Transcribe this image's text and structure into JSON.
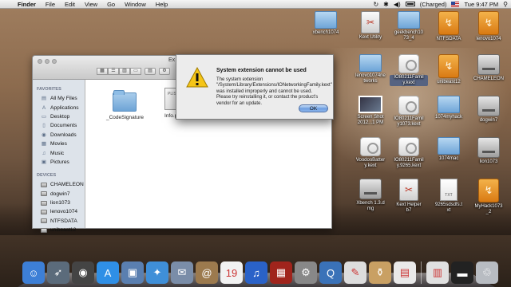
{
  "menubar": {
    "apple_glyph": "",
    "items": [
      "Finder",
      "File",
      "Edit",
      "View",
      "Go",
      "Window",
      "Help"
    ],
    "battery_text": "(Charged)",
    "clock": "Tue 9:47 PM"
  },
  "finder": {
    "title_fragment": "Ex",
    "sidebar": {
      "favorites_header": "FAVORITES",
      "favorites": [
        {
          "label": "All My Files",
          "icon": "all-files-icon"
        },
        {
          "label": "Applications",
          "icon": "applications-icon"
        },
        {
          "label": "Desktop",
          "icon": "desktop-icon"
        },
        {
          "label": "Documents",
          "icon": "documents-icon"
        },
        {
          "label": "Downloads",
          "icon": "downloads-icon"
        },
        {
          "label": "Movies",
          "icon": "movies-icon"
        },
        {
          "label": "Music",
          "icon": "music-icon"
        },
        {
          "label": "Pictures",
          "icon": "pictures-icon"
        }
      ],
      "devices_header": "DEVICES",
      "devices": [
        "CHAMELEON",
        "dogwin7",
        "lion1073",
        "lenovo1074",
        "NTFSDATA",
        "unibeast12"
      ]
    },
    "files": [
      {
        "name": "_CodeSignature",
        "kind": "folder"
      },
      {
        "name": "Info.p",
        "kind": "plist",
        "tag": "PLIST"
      }
    ]
  },
  "alert": {
    "title": "System extension cannot be used",
    "message": "The system extension \"/System/Library/Extensions/IONetworkingFamily.kext\" was installed improperly and cannot be used. Please try reinstalling it, or contact the product's vendor for an update.",
    "ok_label": "OK"
  },
  "desktop_icons": [
    {
      "label": "xbench1074",
      "icon": "folder-icon"
    },
    {
      "label": "Kext Utility",
      "icon": "kext-utility-icon"
    },
    {
      "label": "geekbench10\n73_4",
      "icon": "folder-icon"
    },
    {
      "label": "NTFSDATA",
      "icon": "usb-drive-icon"
    },
    {
      "label": "lenovo1074",
      "icon": "usb-drive-icon"
    },
    {
      "label": "lenovo1074ne\ntworks",
      "icon": "folder-icon"
    },
    {
      "label": "IO80211Famil\ny.kext",
      "icon": "kext-icon"
    },
    {
      "label": "unibeast12",
      "icon": "usb-drive-icon"
    },
    {
      "label": "CHAMELEON",
      "icon": "disk-icon"
    },
    {
      "label": "Screen Shot\n2012...1 PM",
      "icon": "screenshot-icon"
    },
    {
      "label": "IO80211Famil\ny1073.kext",
      "icon": "kext-icon"
    },
    {
      "label": "1074myhack",
      "icon": "folder-icon"
    },
    {
      "label": "dogwin7",
      "icon": "disk-icon"
    },
    {
      "label": "VoodooBatter\ny.kext",
      "icon": "kext-icon"
    },
    {
      "label": "IO80211Famil\ny.9265.kext",
      "icon": "kext-icon"
    },
    {
      "label": "1074mac",
      "icon": "folder-icon"
    },
    {
      "label": "lion1073",
      "icon": "disk-icon"
    },
    {
      "label": "Xbench 1.3.d\nmg",
      "icon": "dmg-icon"
    },
    {
      "label": "Kext Helper\nb7",
      "icon": "kext-helper-icon"
    },
    {
      "label": "9265sdsdfs.t\nxt",
      "icon": "text-file-icon"
    },
    {
      "label": "MyHack1073\n_2",
      "icon": "usb-drive-icon"
    }
  ],
  "dock": [
    {
      "name": "finder-icon",
      "glyph": "☺",
      "color": "#3d7fd6"
    },
    {
      "name": "launchpad-icon",
      "glyph": "➶",
      "color": "#5b6b7b"
    },
    {
      "name": "dashboard-icon",
      "glyph": "◉",
      "color": "#444"
    },
    {
      "name": "app-store-icon",
      "glyph": "A",
      "color": "#2f8fe6"
    },
    {
      "name": "preview-icon",
      "glyph": "▣",
      "color": "#5a7fb0"
    },
    {
      "name": "safari-icon",
      "glyph": "✦",
      "color": "#3f8fd8"
    },
    {
      "name": "mail-icon",
      "glyph": "✉",
      "color": "#7a8da8"
    },
    {
      "name": "contacts-icon",
      "glyph": "@",
      "color": "#9c7a4e"
    },
    {
      "name": "calendar-icon",
      "glyph": "19",
      "color": "#f2f2f2"
    },
    {
      "name": "itunes-icon",
      "glyph": "♫",
      "color": "#2a62c8"
    },
    {
      "name": "photo-booth-icon",
      "glyph": "▦",
      "color": "#a0241c"
    },
    {
      "name": "system-preferences-icon",
      "glyph": "⚙",
      "color": "#888"
    },
    {
      "name": "network-utility-icon",
      "glyph": "Q",
      "color": "#3a72b8"
    },
    {
      "name": "text-edit-icon",
      "glyph": "✎",
      "color": "#ddd"
    },
    {
      "name": "kext-helper-icon",
      "glyph": "⚱",
      "color": "#c9a063"
    },
    {
      "name": "document-icon",
      "glyph": "▤",
      "color": "#e9e9e9"
    },
    {
      "name": "file-icon",
      "glyph": "▥",
      "color": "#e0e0e0"
    },
    {
      "name": "terminal-icon",
      "glyph": "▬",
      "color": "#222"
    },
    {
      "name": "trash-icon",
      "glyph": "♲",
      "color": "#b8bcc2"
    }
  ]
}
